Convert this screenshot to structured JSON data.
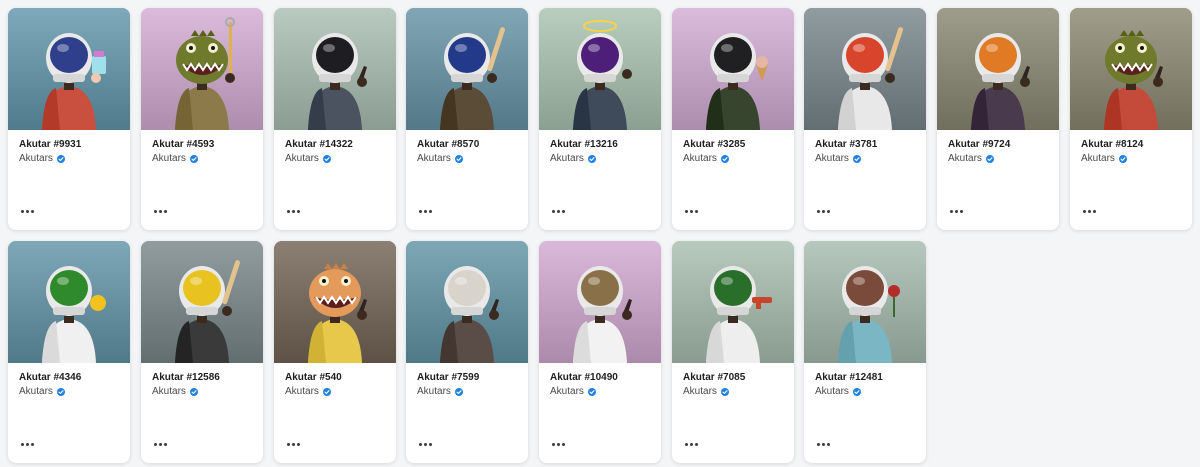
{
  "cards": [
    {
      "title": "Akutar #9931",
      "collection": "Akutars",
      "bg": "#6b97a8",
      "helmet": "#2f3f8c",
      "head": "helmet",
      "body": "#c9503f",
      "prop": "cup"
    },
    {
      "title": "Akutar #4593",
      "collection": "Akutars",
      "bg": "#c9a8c8",
      "helmet": "#6f7a2c",
      "head": "dino",
      "body": "#8c7a4a",
      "prop": "stick"
    },
    {
      "title": "Akutar #14322",
      "collection": "Akutars",
      "bg": "#a7b8ae",
      "helmet": "#1e1e22",
      "head": "helmet",
      "body": "#4b5260",
      "prop": "hand"
    },
    {
      "title": "Akutar #8570",
      "collection": "Akutars",
      "bg": "#6f95a4",
      "helmet": "#233a8a",
      "head": "helmet",
      "body": "#5a4c36",
      "prop": "bat"
    },
    {
      "title": "Akutar #13216",
      "collection": "Akutars",
      "bg": "#a8bcae",
      "helmet": "#4d1f78",
      "head": "helmet",
      "body": "#3f4a5a",
      "prop": "halo"
    },
    {
      "title": "Akutar #3285",
      "collection": "Akutars",
      "bg": "#c8a9c9",
      "helmet": "#202022",
      "head": "helmet",
      "body": "#38452e",
      "prop": "cone"
    },
    {
      "title": "Akutar #3781",
      "collection": "Akutars",
      "bg": "#7f8a8e",
      "helmet": "#d9452c",
      "head": "helmet",
      "body": "#e8e8e8",
      "prop": "bat"
    },
    {
      "title": "Akutar #9724",
      "collection": "Akutars",
      "bg": "#8c8a78",
      "helmet": "#e07a24",
      "head": "helmet",
      "body": "#4a3a4e",
      "prop": "hand"
    },
    {
      "title": "Akutar #8124",
      "collection": "Akutars",
      "bg": "#8e8c78",
      "helmet": "#6f7a2c",
      "head": "dino",
      "body": "#c44a3a",
      "prop": "hand"
    },
    {
      "title": "Akutar #4346",
      "collection": "Akutars",
      "bg": "#6c96a6",
      "helmet": "#2e8a2a",
      "head": "helmet",
      "body": "#f0f0f0",
      "prop": "ball"
    },
    {
      "title": "Akutar #12586",
      "collection": "Akutars",
      "bg": "#7e8a8c",
      "helmet": "#e8c21e",
      "head": "helmet",
      "body": "#3a3a3a",
      "prop": "bat"
    },
    {
      "title": "Akutar #540",
      "collection": "Akutars",
      "bg": "#7a6e62",
      "helmet": "#e39a5a",
      "head": "dino",
      "body": "#e8c84a",
      "prop": "hand"
    },
    {
      "title": "Akutar #7599",
      "collection": "Akutars",
      "bg": "#6c95a4",
      "helmet": "#d8d4cc",
      "head": "helmet",
      "body": "#5a4c46",
      "prop": "hand"
    },
    {
      "title": "Akutar #10490",
      "collection": "Akutars",
      "bg": "#c8a6c8",
      "helmet": "#8a7048",
      "head": "helmet",
      "body": "#f2f2f2",
      "prop": "hand"
    },
    {
      "title": "Akutar #7085",
      "collection": "Akutars",
      "bg": "#a6b8ac",
      "helmet": "#2a6e2c",
      "head": "helmet",
      "body": "#eeeeee",
      "prop": "gun"
    },
    {
      "title": "Akutar #12481",
      "collection": "Akutars",
      "bg": "#a4b6ac",
      "helmet": "#7a4a3a",
      "head": "helmet",
      "body": "#7ab6c4",
      "prop": "flower"
    }
  ],
  "more_icon": "ellipsis-icon",
  "verified_icon": "verified-check-icon",
  "verified_color": "#2081e2"
}
